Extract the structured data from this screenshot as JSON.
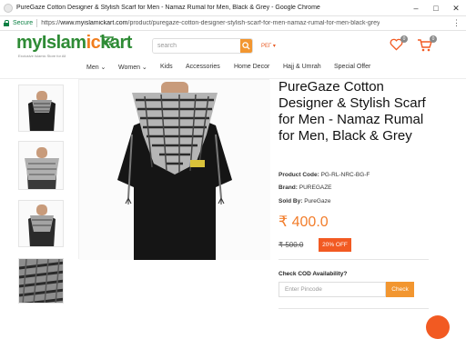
{
  "window": {
    "title": "PureGaze Cotton Designer & Stylish Scarf for Men - Namaz Rumal for Men, Black & Grey - Google Chrome",
    "minimize": "–",
    "maximize": "□",
    "close": "✕"
  },
  "address": {
    "secure_label": "Secure",
    "url_prefix": "https://",
    "url_host": "www.myislamickart.com",
    "url_path": "/product/puregaze-cotton-designer-stylish-scarf-for-men-namaz-rumal-for-men-black-grey",
    "menu": "⋮"
  },
  "header": {
    "logo_part1": "myIslam",
    "logo_part2": "ic",
    "logo_part3": "kart",
    "logo_tagline": "Exclusive Islamic Store for All",
    "search_placeholder": "search",
    "lang": "РЕГ ▾",
    "wishlist_count": "0",
    "cart_count": "0",
    "brand_green": "#2e8b35",
    "brand_orange": "#f29630"
  },
  "nav": {
    "items": [
      "Men ⌄",
      "Women ⌄",
      "Kids",
      "Accessories",
      "Home Decor",
      "Hajj & Umrah",
      "Special Offer"
    ]
  },
  "product": {
    "title": "PureGaze Cotton Designer & Stylish Scarf for Men - Namaz Rumal for Men, Black & Grey",
    "code_label": "Product Code:",
    "code": "PG-RL-NRC-BG-F",
    "brand_label": "Brand:",
    "brand": "PUREGAZE",
    "sold_label": "Sold By:",
    "sold_by": "PureGaze",
    "price": "₹ 400.0",
    "old_price": "₹ 500.0",
    "discount": "20% OFF",
    "cod_label": "Check COD Availability?",
    "pin_placeholder": "Enter Pincode",
    "check_label": "Check"
  }
}
